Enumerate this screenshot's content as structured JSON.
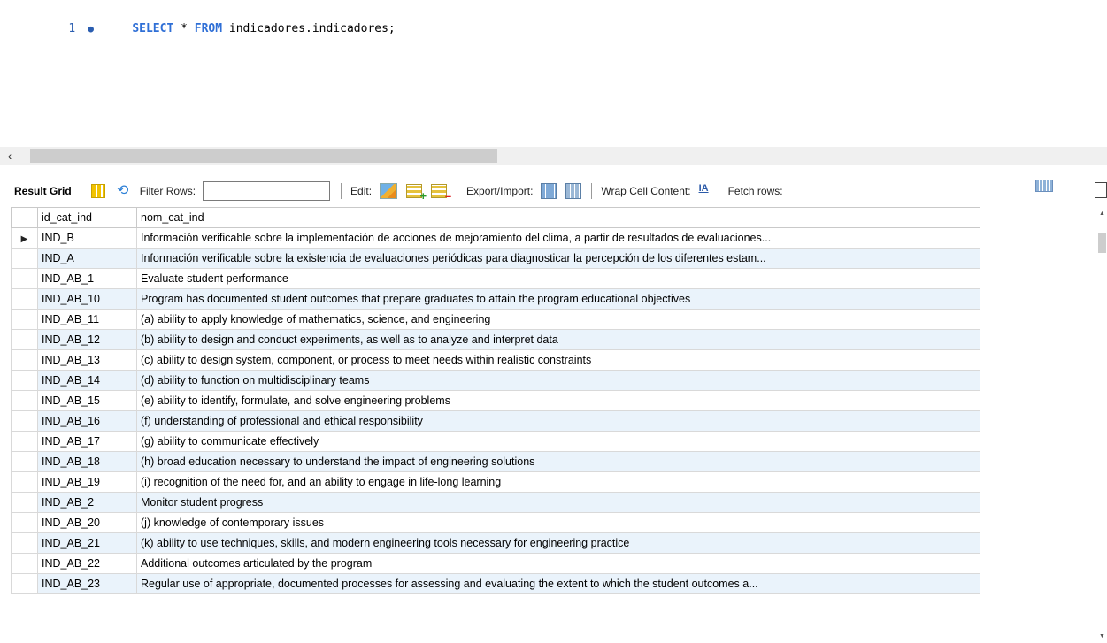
{
  "editor": {
    "line_number": "1",
    "keyword_select": "SELECT",
    "star": " * ",
    "keyword_from": "FROM",
    "rest": " indicadores.indicadores;"
  },
  "toolbar": {
    "result_grid": "Result Grid",
    "filter_rows": "Filter Rows:",
    "filter_value": "",
    "edit": "Edit:",
    "export_import": "Export/Import:",
    "wrap_cell": "Wrap Cell Content:",
    "wrap_icon_text": "IA",
    "fetch_rows": "Fetch rows:"
  },
  "grid": {
    "columns": [
      "id_cat_ind",
      "nom_cat_ind"
    ],
    "rows": [
      [
        "IND_B",
        "Información verificable sobre la implementación de acciones de mejoramiento del clima, a partir de resultados de evaluaciones..."
      ],
      [
        "IND_A",
        "Información verificable sobre la existencia de evaluaciones periódicas para diagnosticar la percepción de los diferentes estam..."
      ],
      [
        "IND_AB_1",
        "Evaluate student performance"
      ],
      [
        "IND_AB_10",
        "Program has documented student outcomes that prepare graduates to attain the program educational objectives"
      ],
      [
        "IND_AB_11",
        "(a) ability to apply knowledge of mathematics, science, and engineering"
      ],
      [
        "IND_AB_12",
        "(b) ability to design and conduct experiments, as well as to analyze and interpret data"
      ],
      [
        "IND_AB_13",
        "(c) ability to design system, component, or process to meet needs within realistic constraints"
      ],
      [
        "IND_AB_14",
        "(d) ability to function on multidisciplinary teams"
      ],
      [
        "IND_AB_15",
        "(e) ability to identify, formulate, and solve engineering problems"
      ],
      [
        "IND_AB_16",
        "(f) understanding of professional and ethical responsibility"
      ],
      [
        "IND_AB_17",
        "(g) ability to communicate effectively"
      ],
      [
        "IND_AB_18",
        "(h) broad education necessary to understand the impact of engineering solutions"
      ],
      [
        "IND_AB_19",
        "(i) recognition of the need for, and an ability to engage in life-long learning"
      ],
      [
        "IND_AB_2",
        "Monitor student progress"
      ],
      [
        "IND_AB_20",
        "(j) knowledge of contemporary issues"
      ],
      [
        "IND_AB_21",
        "(k) ability to use techniques, skills, and modern engineering tools necessary for engineering practice"
      ],
      [
        "IND_AB_22",
        "Additional outcomes articulated by the program"
      ],
      [
        "IND_AB_23",
        "Regular use of appropriate, documented processes for assessing and evaluating the extent to which the student outcomes a..."
      ]
    ],
    "selected_row_marker": "▶"
  }
}
